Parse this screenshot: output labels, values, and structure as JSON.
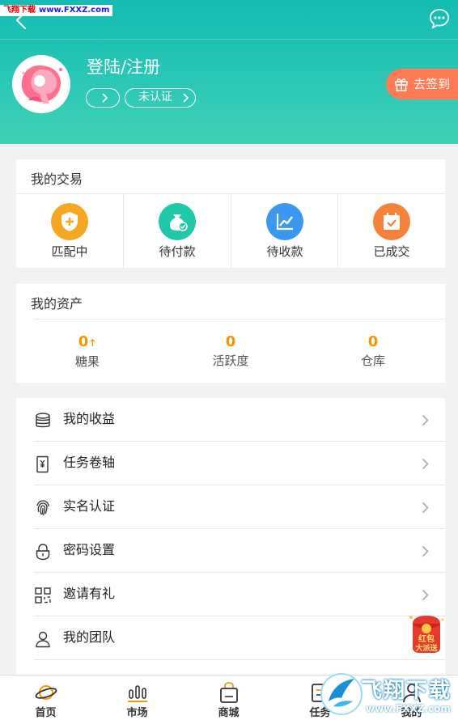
{
  "watermark_top": {
    "site_name": "飞翔下载",
    "url": "www.FXXZ.com"
  },
  "profile": {
    "login_label": "登陆/注册",
    "verify_label": "未认证"
  },
  "signin": {
    "label": "去签到"
  },
  "trade": {
    "title": "我的交易",
    "items": [
      {
        "label": "匹配中",
        "icon": "shield-plus-icon",
        "color": "#f5a623"
      },
      {
        "label": "待付款",
        "icon": "money-bag-icon",
        "color": "#1fc8a6"
      },
      {
        "label": "待收款",
        "icon": "chart-line-icon",
        "color": "#3b97f0"
      },
      {
        "label": "已成交",
        "icon": "calendar-check-icon",
        "color": "#f5823c"
      }
    ]
  },
  "assets": {
    "title": "我的资产",
    "items": [
      {
        "value": "0",
        "label": "糖果",
        "arrow": "↑"
      },
      {
        "value": "0",
        "label": "活跃度"
      },
      {
        "value": "0",
        "label": "仓库"
      }
    ]
  },
  "menu": [
    {
      "label": "我的收益",
      "icon": "coins-stack-icon"
    },
    {
      "label": "任务卷轴",
      "icon": "yen-document-icon"
    },
    {
      "label": "实名认证",
      "icon": "fingerprint-icon"
    },
    {
      "label": "密码设置",
      "icon": "lock-icon"
    },
    {
      "label": "邀请有礼",
      "icon": "qr-code-icon"
    },
    {
      "label": "我的团队",
      "icon": "user-icon"
    }
  ],
  "red_packet": {
    "label_line1": "红包",
    "label_line2": "大派送"
  },
  "tabs": [
    {
      "label": "首页",
      "icon": "planet-icon"
    },
    {
      "label": "市场",
      "icon": "bars-icon"
    },
    {
      "label": "商城",
      "icon": "shopping-bag-icon"
    },
    {
      "label": "任务",
      "icon": "task-icon"
    },
    {
      "label": "我的",
      "icon": "profile-icon"
    }
  ],
  "watermark_logo": {
    "text": "飞翔下载",
    "url": "www.FXXZ.com"
  },
  "colors": {
    "header": "#12bcb2",
    "accent_orange": "#f39800",
    "signin_bg": "#ff7a55"
  }
}
